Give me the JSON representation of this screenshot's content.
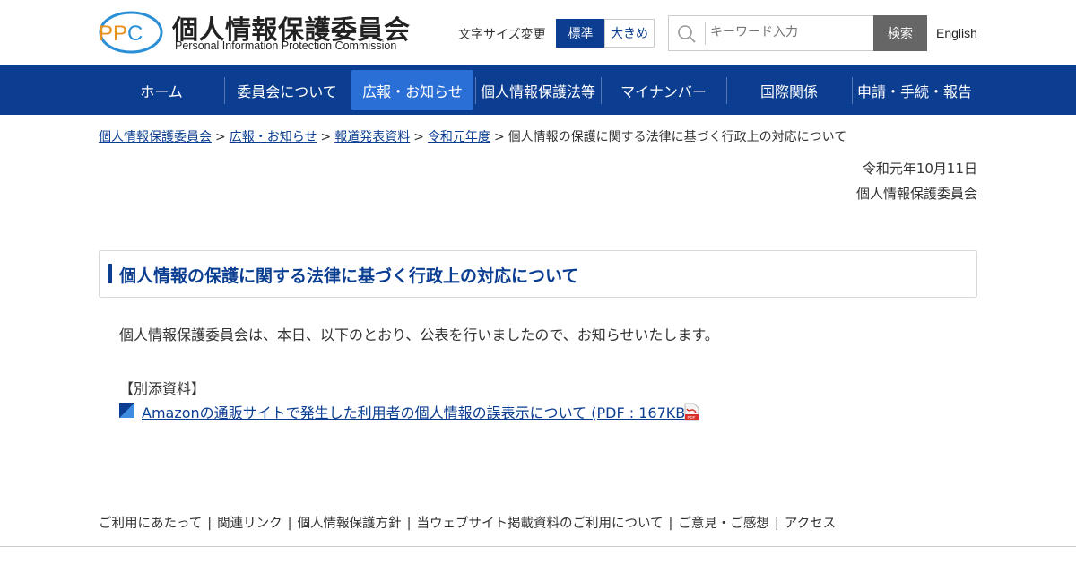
{
  "header": {
    "logo_mark": "PPC",
    "logo_title": "個人情報保護委員会",
    "logo_subtitle": "Personal Information Protection Commission",
    "fontsize_label": "文字サイズ変更",
    "fontsize_standard": "標準",
    "fontsize_large": "大きめ",
    "search_placeholder": "キーワード入力",
    "search_button": "検索",
    "english_link": "English"
  },
  "nav": {
    "items": [
      {
        "label": "ホーム"
      },
      {
        "label": "委員会について"
      },
      {
        "label": "広報・お知らせ"
      },
      {
        "label": "個人情報保護法等"
      },
      {
        "label": "マイナンバー"
      },
      {
        "label": "国際関係"
      },
      {
        "label": "申請・手続・報告"
      }
    ],
    "active": "広報・お知らせ"
  },
  "breadcrumb": {
    "items": [
      "個人情報保護委員会",
      "広報・お知らせ",
      "報道発表資料",
      "令和元年度"
    ],
    "separator": ">",
    "current": "個人情報の保護に関する法律に基づく行政上の対応について"
  },
  "meta": {
    "date": "令和元年10月11日",
    "organization": "個人情報保護委員会"
  },
  "main": {
    "title": "個人情報の保護に関する法律に基づく行政上の対応について",
    "body": "個人情報保護委員会は、本日、以下のとおり、公表を行いましたので、お知らせいたします。",
    "attachments_heading": "【別添資料】",
    "attachment_link": "Amazonの通販サイトで発生した利用者の個人情報の誤表示について (PDF : 167KB)"
  },
  "footer": {
    "links": [
      "ご利用にあたって",
      "関連リンク",
      "個人情報保護方針",
      "当ウェブサイト掲載資料のご利用について",
      "ご意見・ご感想",
      "アクセス"
    ],
    "separator": "|"
  },
  "colors": {
    "brand_navy": "#0b3d91",
    "nav_active": "#2a6fd6",
    "search_button": "#666666",
    "logo_orange": "#e8901e",
    "logo_blue": "#2a8fd6"
  },
  "icons": {
    "search": "magnifier-icon",
    "bullet": "blue-triangle-bullet-icon",
    "pdf": "pdf-file-icon"
  }
}
